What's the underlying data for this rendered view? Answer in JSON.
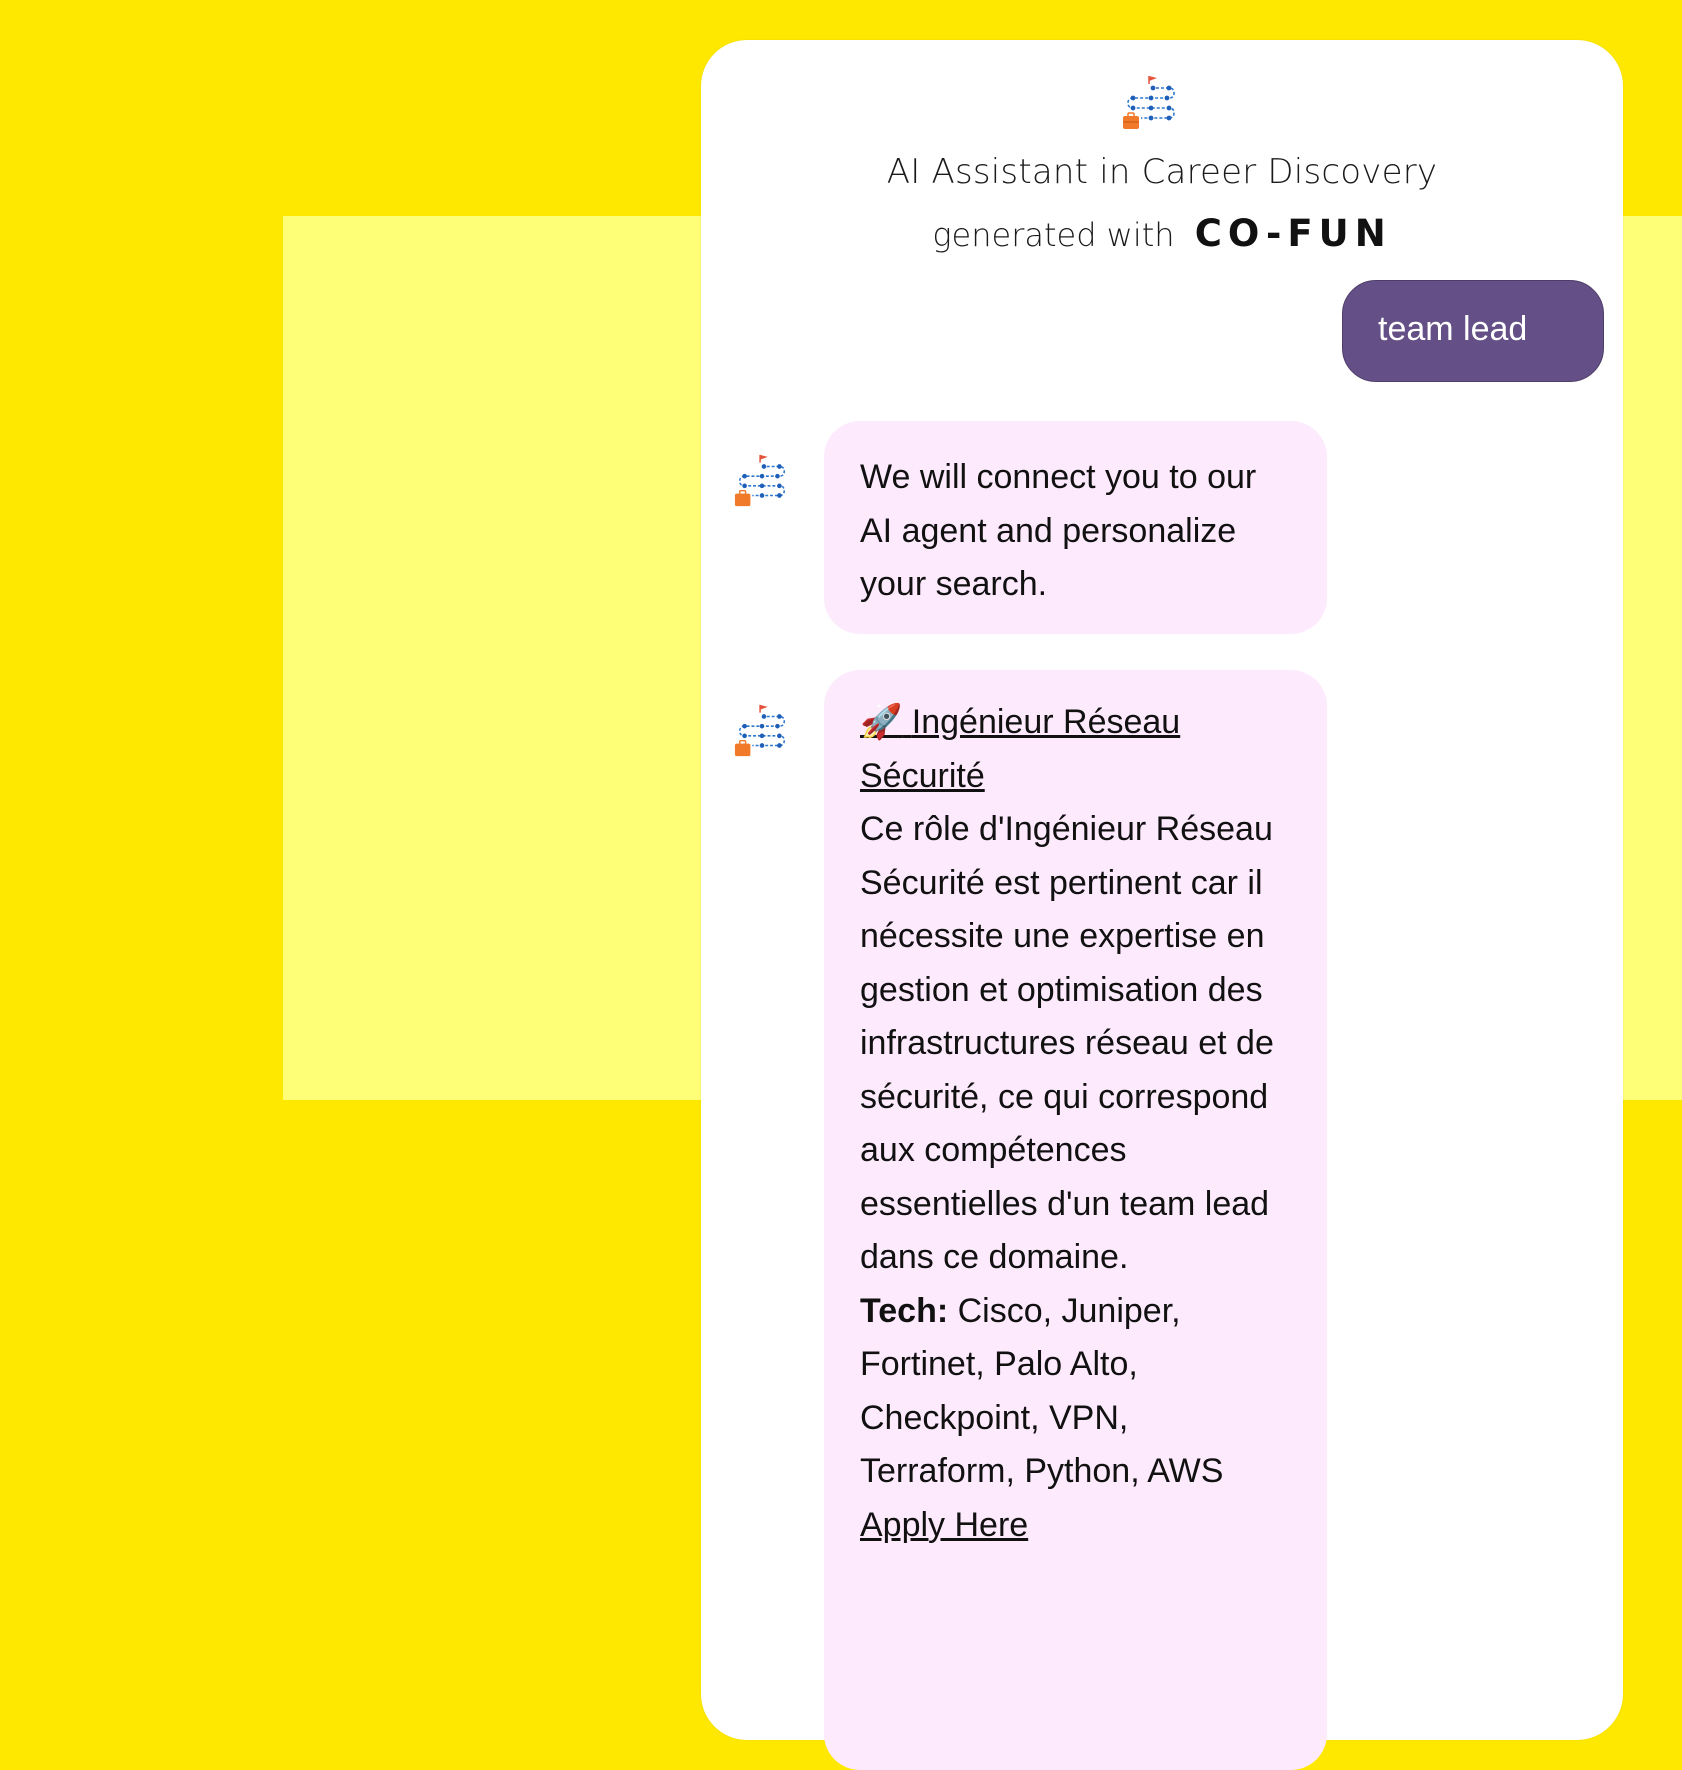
{
  "header": {
    "title": "AI Assistant in Career Discovery",
    "subtitle_prefix": "generated with",
    "brand": "CO-FUN",
    "logo_icon": "career-path-logo-icon"
  },
  "messages": {
    "user": {
      "text": "team lead"
    },
    "bot_intro": {
      "text": "We will connect you to our AI agent and personalize your search."
    },
    "bot_job": {
      "emoji": "🚀",
      "job_title": "Ingénieur Réseau Sécurité",
      "description": "Ce rôle d'Ingénieur Réseau Sécurité est pertinent car il nécessite une expertise en gestion et optimisation des infrastructures réseau et de sécurité, ce qui correspond aux compétences essentielles d'un team lead dans ce domaine.",
      "tech_label": "Tech:",
      "tech_list": "Cisco, Juniper, Fortinet, Palo Alto, Checkpoint, VPN, Terraform, Python, AWS",
      "apply_label": "Apply Here"
    }
  },
  "colors": {
    "background": "#ffe800",
    "panel": "#ffff77",
    "user_bubble": "#645086",
    "bot_bubble": "#fdeafd"
  }
}
